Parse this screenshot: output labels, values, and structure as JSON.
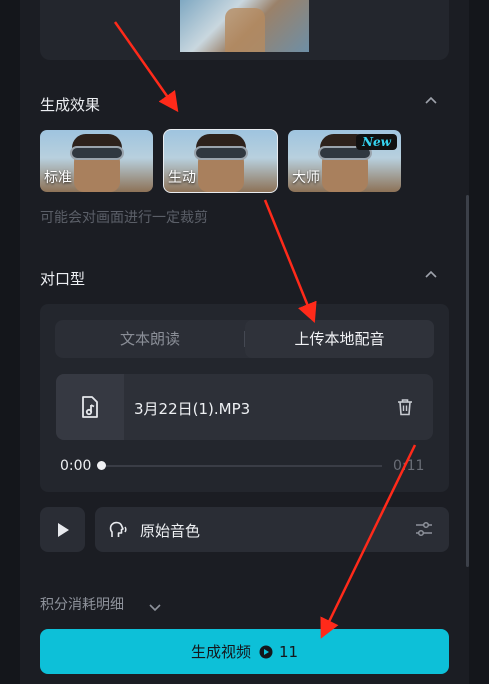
{
  "colors": {
    "accent": "#0dc0d8",
    "annotation_arrow": "#ff2a1a",
    "new_badge": "#36d4f0"
  },
  "effects_section": {
    "title": "生成效果",
    "options": [
      {
        "label": "标准",
        "selected": false,
        "badge": ""
      },
      {
        "label": "生动",
        "selected": true,
        "badge": ""
      },
      {
        "label": "大师",
        "selected": false,
        "badge": "New"
      }
    ],
    "hint": "可能会对画面进行一定裁剪"
  },
  "lip_sync_section": {
    "title": "对口型",
    "tabs": [
      {
        "label": "文本朗读",
        "active": false
      },
      {
        "label": "上传本地配音",
        "active": true
      }
    ],
    "file": {
      "name": "3月22日(1).MP3",
      "icon": "audio-file-icon"
    },
    "player": {
      "current_time": "0:00",
      "total_time": "0:11",
      "progress": 0.0
    },
    "voice": {
      "label": "原始音色",
      "icon": "voice-head-icon"
    }
  },
  "footer": {
    "points_detail": "积分消耗明细",
    "generate_label": "生成视频",
    "cost": "11"
  }
}
